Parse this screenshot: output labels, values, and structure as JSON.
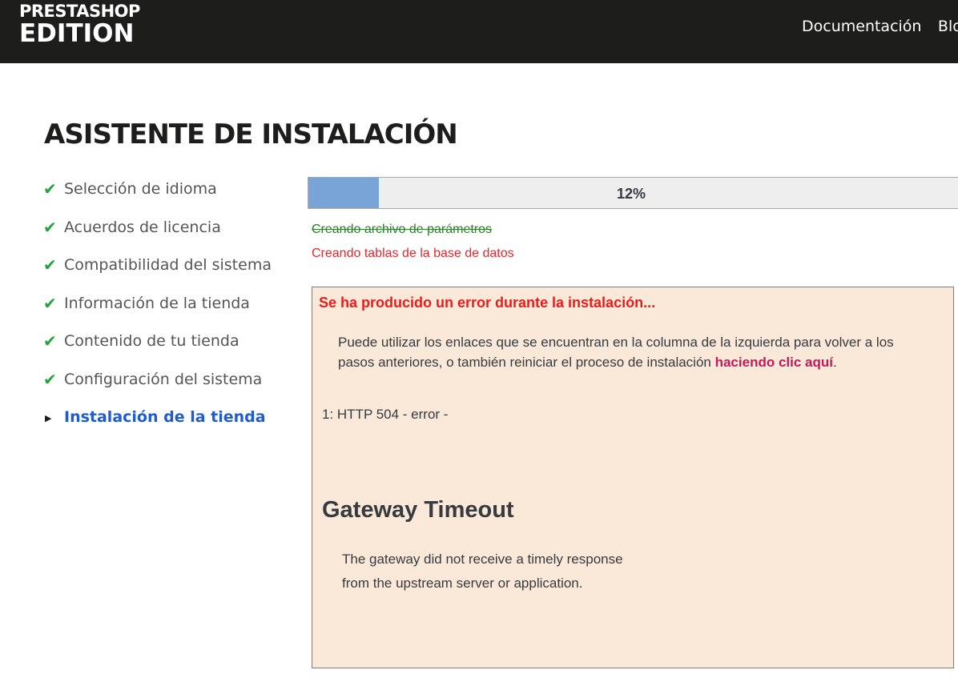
{
  "header": {
    "logo_line1": "PRESTASHOP",
    "logo_line2": "EDITION",
    "nav": [
      "Documentación",
      "Blog"
    ]
  },
  "page_title": "ASISTENTE DE INSTALACIÓN",
  "steps": [
    {
      "label": "Selección de idioma",
      "status": "done"
    },
    {
      "label": "Acuerdos de licencia",
      "status": "done"
    },
    {
      "label": "Compatibilidad del sistema",
      "status": "done"
    },
    {
      "label": "Información de la tienda",
      "status": "done"
    },
    {
      "label": "Contenido de tu tienda",
      "status": "done"
    },
    {
      "label": "Configuración del sistema",
      "status": "done"
    },
    {
      "label": "Instalación de la tienda",
      "status": "current"
    }
  ],
  "icons": {
    "done": "check-icon",
    "current": "triangle-right-icon"
  },
  "progress": {
    "percent": 12,
    "label": "12%"
  },
  "tasks": {
    "done": "Creando archivo de parámetros",
    "current": "Creando tablas de la base de datos"
  },
  "error": {
    "title": "Se ha producido un error durante la instalación...",
    "message_before": "Puede utilizar los enlaces que se encuentran en la columna de la izquierda para volver a los pasos anteriores, o también reiniciar el proceso de instalación ",
    "link": "haciendo clic aquí",
    "message_after": ".",
    "code": "1: HTTP 504 - error -",
    "gateway_title": "Gateway Timeout",
    "gateway_line1": "The gateway did not receive a timely response",
    "gateway_line2": "from the upstream server or application."
  },
  "colors": {
    "header_bg": "#1d1d1b",
    "check": "#22a33a",
    "current_step": "#1f5bd1",
    "progress_fill": "#78a4d8",
    "task_done": "#2f7d2f",
    "task_current": "#e3282d",
    "error_bg": "#fae8d8",
    "error_title": "#e81d1d",
    "link": "#c4185c"
  }
}
